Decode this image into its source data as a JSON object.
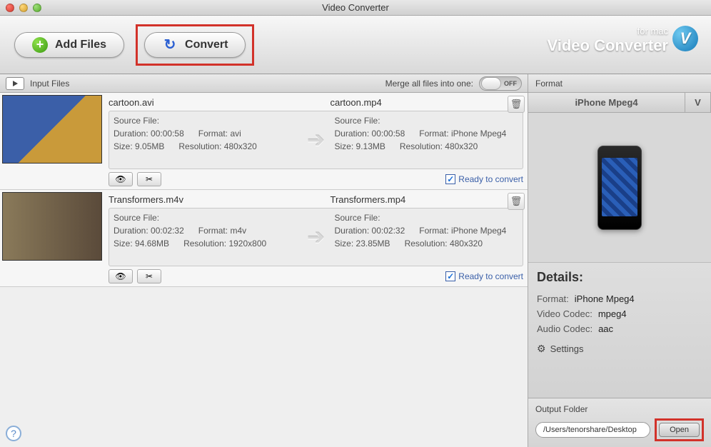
{
  "window": {
    "title": "Video Converter"
  },
  "toolbar": {
    "add_label": "Add Files",
    "convert_label": "Convert"
  },
  "brand": {
    "small": "for mac",
    "large": "Video Converter",
    "badge": "V"
  },
  "subheader": {
    "input_label": "Input Files",
    "merge_label": "Merge all files into one:",
    "toggle_state": "OFF"
  },
  "labels": {
    "source_file": "Source File:",
    "duration": "Duration:",
    "format": "Format:",
    "size": "Size:",
    "resolution": "Resolution:",
    "ready": "Ready to convert"
  },
  "files": [
    {
      "in_name": "cartoon.avi",
      "out_name": "cartoon.mp4",
      "in": {
        "duration": "00:00:58",
        "format": "avi",
        "size": "9.05MB",
        "resolution": "480x320"
      },
      "out": {
        "duration": "00:00:58",
        "format": "iPhone Mpeg4",
        "size": "9.13MB",
        "resolution": "480x320"
      },
      "ready": true
    },
    {
      "in_name": "Transformers.m4v",
      "out_name": "Transformers.mp4",
      "in": {
        "duration": "00:02:32",
        "format": "m4v",
        "size": "94.68MB",
        "resolution": "1920x800"
      },
      "out": {
        "duration": "00:02:32",
        "format": "iPhone Mpeg4",
        "size": "23.85MB",
        "resolution": "480x320"
      },
      "ready": true
    }
  ],
  "format_panel": {
    "header": "Format",
    "tab_main": "iPhone Mpeg4",
    "tab_side": "V",
    "details_title": "Details:",
    "format_k": "Format:",
    "format_v": "iPhone Mpeg4",
    "vcodec_k": "Video Codec:",
    "vcodec_v": "mpeg4",
    "acodec_k": "Audio Codec:",
    "acodec_v": "aac",
    "settings": "Settings"
  },
  "output": {
    "label": "Output Folder",
    "path": "/Users/tenorshare/Desktop",
    "open": "Open"
  },
  "help": "?"
}
